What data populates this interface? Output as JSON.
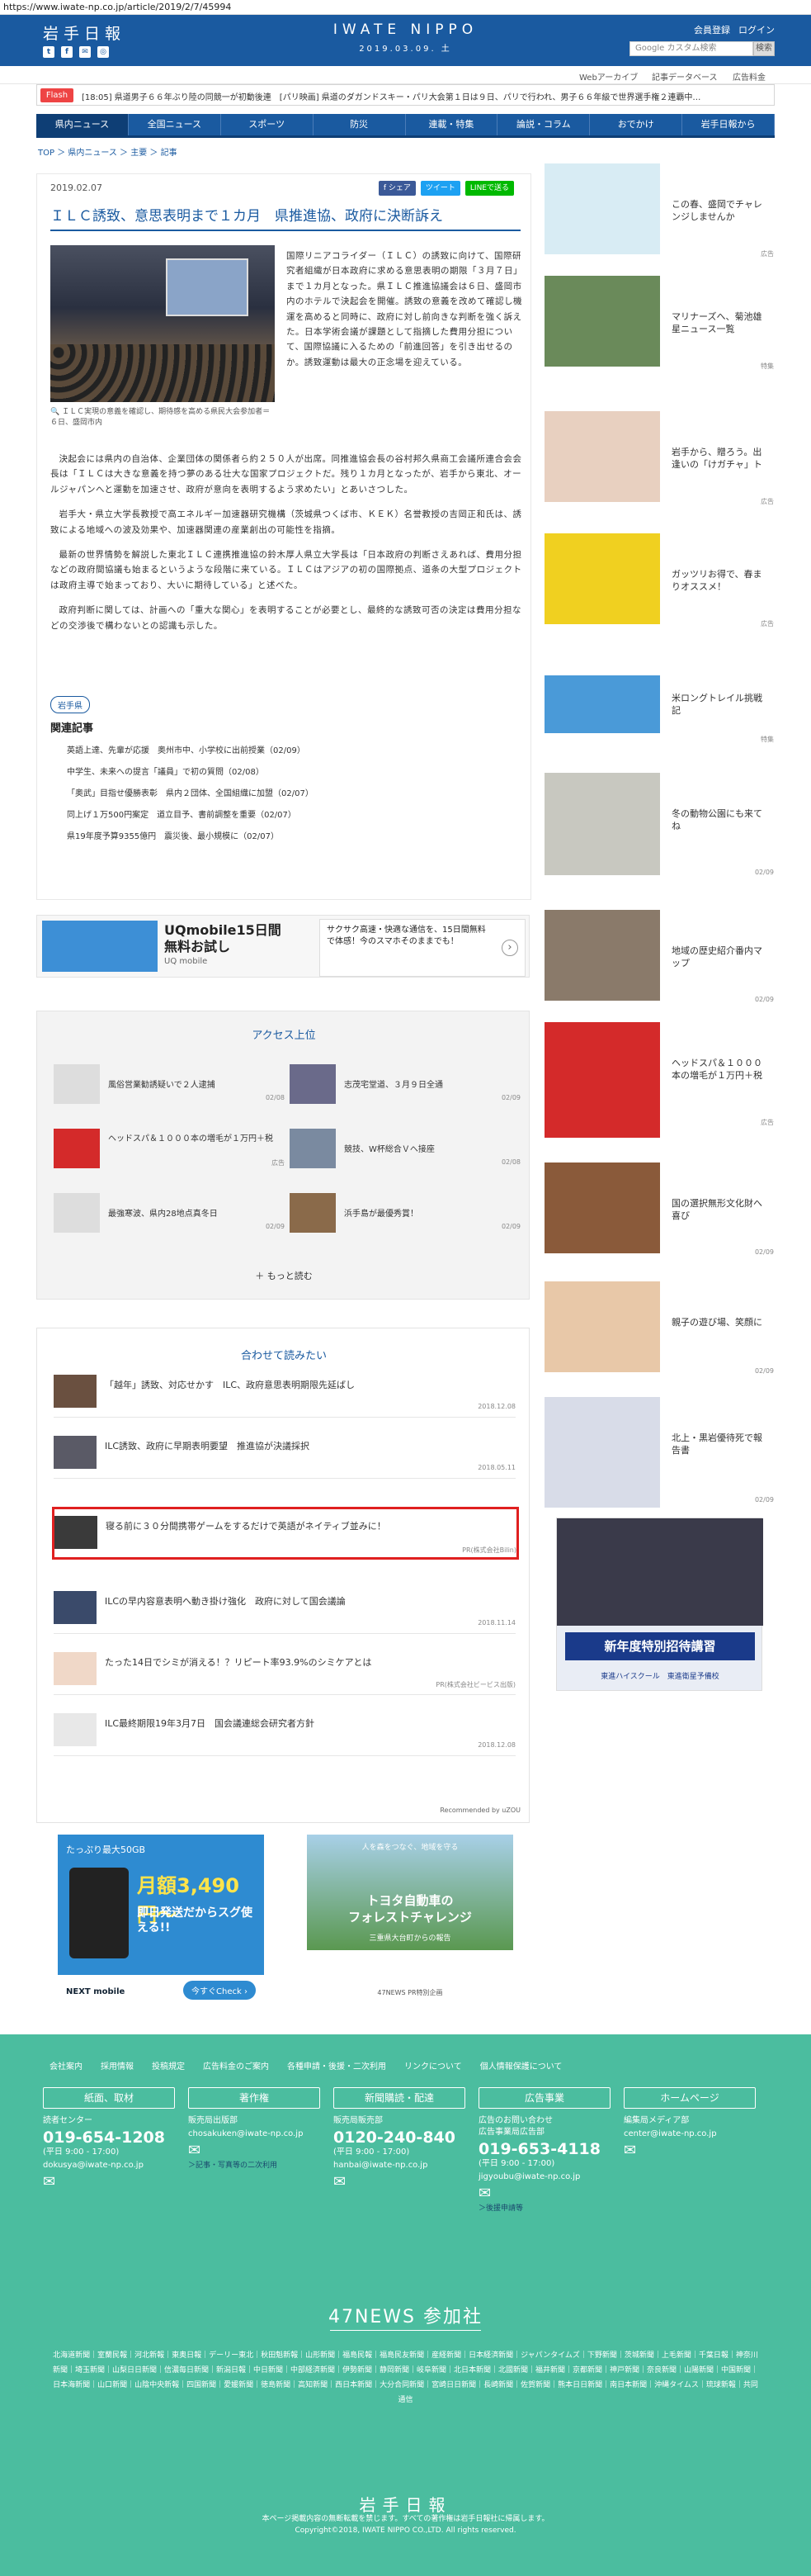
{
  "url": "https://www.iwate-np.co.jp/article/2019/2/7/45994",
  "header": {
    "logo": "岩手日報",
    "center_logo": "IWATE NIPPO",
    "date": "2019.03.09. 土",
    "links": [
      "会員登録",
      "ログイン"
    ],
    "search_placeholder": "Google カスタム検索",
    "search_button": "検索",
    "social": [
      "t",
      "f",
      "✉",
      "◎"
    ]
  },
  "subnav": [
    "Webアーカイブ",
    "記事データベース",
    "広告料金"
  ],
  "flash": {
    "label": "Flash",
    "text": "[18:05] 県道男子６６年ぶり陸の同競一が初動後連　[パリ映画] 県道のダガンドスキー・パリ大会第１日は９日、パリで行われ、男子６６年級で世界選手権２連覇中…"
  },
  "gnav": [
    "県内ニュース",
    "全国ニュース",
    "スポーツ",
    "防災",
    "連載・特集",
    "論説・コラム",
    "おでかけ",
    "岩手日報から"
  ],
  "breadcrumb": "TOP ＞ 県内ニュース ＞ 主要 ＞ 記事",
  "article": {
    "date": "2019.02.07",
    "share": [
      "f シェア",
      "ツイート",
      "LINEで送る"
    ],
    "title": "ＩＬＣ誘致、意思表明まで１カ月　県推進協、政府に決断訴え",
    "caption": "ＩＬＣ実現の意義を確認し、期待感を高める県民大会参加者＝６日、盛岡市内",
    "lead": "国際リニアコライダー（ＩＬＣ）の誘致に向けて、国際研究者組織が日本政府に求める意思表明の期限「３月７日」まで１カ月となった。県ＩＬＣ推進協議会は６日、盛岡市内のホテルで決起会を開催。誘致の意義を改めて確認し機運を高めると同時に、政府に対し前向きな判断を強く訴えた。日本学術会議が課題として指摘した費用分担について、国際協議に入るための「前進回答」を引き出せるのか。誘致運動は最大の正念場を迎えている。",
    "paragraphs": [
      "決起会には県内の自治体、企業団体の関係者ら約２５０人が出席。同推進協会長の谷村邦久県商工会議所連合会会長は「ＩＬＣは大きな意義を持つ夢のある壮大な国家プロジェクトだ。残り１カ月となったが、岩手から東北、オールジャパンへと運動を加速させ、政府が意向を表明するよう求めたい」とあいさつした。",
      "岩手大・県立大学長教授で高エネルギー加速器研究機構（茨城県つくば市、ＫＥＫ）名誉教授の吉岡正和氏は、誘致による地域への波及効果や、加速器関連の産業創出の可能性を指摘。",
      "最新の世界情勢を解説した東北ＩＬＣ連携推進協の鈴木厚人県立大学長は「日本政府の判断さえあれば、費用分担などの政府間協議も始まるというような段階に来ている。ＩＬＣはアジアの初の国際拠点、道条の大型プロジェクトは政府主導で始まっており、大いに期待している」と述べた。",
      "政府判断に関しては、計画への「重大な関心」を表明することが必要とし、最終的な誘致可否の決定は費用分担などの交渉後で構わないとの認識も示した。"
    ],
    "tag": "岩手県",
    "related_heading": "関連記事",
    "related": [
      "英語上達、先輩が応援　奥州市中、小学校に出前授業（02/09）",
      "中学生、未来への提言「議員」で初の質問（02/08）",
      "「奥武」目指せ優勝表彰　県内２団体、全国組織に加盟（02/07）",
      "同上げ１万500円案定　道立目予、書前調整を重要（02/07）",
      "県19年度予算9355億円　震災後、最小規模に（02/07）"
    ]
  },
  "ad_banner": {
    "title": "UQmobile15日間\n無料お試し",
    "sub": "UQ mobile",
    "right_text": "サクサク高速・快適な通信を、15日間無料で体感！今のスマホそのままでも！",
    "arrow": "›"
  },
  "ranking": {
    "heading": "アクセス上位",
    "items": [
      {
        "title": "風俗営業勧誘疑いで２人逮捕",
        "date": "02/08"
      },
      {
        "title": "志茂宅堂道、３月９日全通",
        "date": "02/09"
      },
      {
        "title": "ヘッドスパ＆１０００本の増毛が１万円＋税",
        "date": "広告"
      },
      {
        "title": "競技、W杯総合Ｖへ接座",
        "date": "02/08"
      },
      {
        "title": "最強寒波、県内28地点真冬日",
        "date": "02/09"
      },
      {
        "title": "浜手島が最優秀賞！",
        "date": "02/09"
      }
    ],
    "more": "＋ もっと読む"
  },
  "recommend": {
    "heading": "合わせて読みたい",
    "items": [
      {
        "title": "「越年」誘致、対応せかす　ILC、政府意思表明期限先延ばし",
        "date": "2018.12.08"
      },
      {
        "title": "ILC誘致、政府に早期表明要望　推進協が決議採択",
        "date": "2018.05.11"
      },
      {
        "title": "寝る前に３０分間携帯ゲームをするだけで英語がネイティブ並みに！",
        "date": "PR(株式会社Bilin)"
      },
      {
        "title": "ILCの早内容意表明へ動き掛け強化　政府に対して国会議論",
        "date": "2018.11.14"
      },
      {
        "title": "たった14日でシミが消える！？リピート率93.9%のシミケアとは",
        "date": "PR(株式会社ビービス出版)"
      },
      {
        "title": "ILC最終期限19年3月7日　国会議連総会研究者方針",
        "date": "2018.12.08"
      }
    ],
    "by": "Recommended by uZOU"
  },
  "bottom_ads": {
    "left_top": "たっぷり最大50GB",
    "left_price": "月額3,490円〜",
    "left_sub": "即日発送だからスグ使える!!",
    "left_btn": "今すぐCheck ›",
    "left_brand": "NEXT mobile",
    "right_top": "人を森をつなぐ、地域を守る",
    "right_title": "トヨタ自動車の\nフォレストチャレンジ",
    "right_sub": "三重県大台町からの報告",
    "right_brand": "47NEWS PR特別企画"
  },
  "sidebar": {
    "items": [
      {
        "title": "この春、盛岡でチャレンジしませんか",
        "date": "広告"
      },
      {
        "title": "マリナーズへ、菊池雄星ニュース一覧",
        "date": "特集"
      },
      {
        "title": "岩手から、贈ろう。出逢いの「けガチャ」ト",
        "date": "広告"
      },
      {
        "title": "ガッツリお得で、春まりオススメ！",
        "date": "広告"
      },
      {
        "title": "米ロングトレイル挑戦記",
        "date": "特集"
      },
      {
        "title": "冬の動物公園にも来てね",
        "date": "02/09"
      },
      {
        "title": "地域の歴史紹介番内マップ",
        "date": "02/09"
      },
      {
        "title": "ヘッドスパ＆１０００本の増毛が１万円＋税",
        "date": "広告"
      },
      {
        "title": "国の選択無形文化財へ喜び",
        "date": "02/09"
      },
      {
        "title": "親子の遊び場、笑顔に",
        "date": "02/09"
      },
      {
        "title": "北上・黒岩優待死で報告書",
        "date": "02/09"
      }
    ],
    "ad_title": "新年度特別招待講習",
    "ad_sub": "東進ハイスクール　東進衛星予備校"
  },
  "footer": {
    "links": [
      "会社案内",
      "採用情報",
      "投稿規定",
      "広告料金のご案内",
      "各種申請・後援・二次利用",
      "リンクについて",
      "個人情報保護について"
    ],
    "columns": [
      {
        "head": "紙面、取材",
        "text": "読者センター",
        "phone": "019-654-1208",
        "hours": "(平日 9:00 - 17:00)",
        "mail": "dokusya@iwate-np.co.jp",
        "link": ""
      },
      {
        "head": "著作権",
        "text": "販売局出版部",
        "phone": "",
        "hours": "",
        "mail": "chosakuken@iwate-np.co.jp",
        "link": "＞記事・写真等の二次利用"
      },
      {
        "head": "新聞購読・配達",
        "text": "販売局販売部",
        "phone": "0120-240-840",
        "hours": "(平日 9:00 - 17:00)",
        "mail": "hanbai@iwate-np.co.jp",
        "link": ""
      },
      {
        "head": "広告事業",
        "text": "広告のお問い合わせ\n広告事業局広告部",
        "phone": "019-653-4118",
        "hours": "(平日 9:00 - 17:00)",
        "mail": "jigyoubu@iwate-np.co.jp",
        "link": "＞後援申請等"
      },
      {
        "head": "ホームページ",
        "text": "編集局メディア部",
        "phone": "",
        "hours": "",
        "mail": "center@iwate-np.co.jp",
        "link": ""
      }
    ],
    "n47": "47NEWS 参加社",
    "papers": "北海道新聞｜室蘭民報｜河北新報｜東奥日報｜デーリー東北｜秋田魁新報｜山形新聞｜福島民報｜福島民友新聞｜産経新聞｜日本経済新聞｜ジャパンタイムズ｜下野新聞｜茨城新聞｜上毛新聞｜千葉日報｜神奈川新聞｜埼玉新聞｜山梨日日新聞｜信濃毎日新聞｜新潟日報｜中日新聞｜中部経済新聞｜伊勢新聞｜静岡新聞｜岐阜新聞｜北日本新聞｜北國新聞｜福井新聞｜京都新聞｜神戸新聞｜奈良新聞｜山陽新聞｜中国新聞｜日本海新聞｜山口新聞｜山陰中央新報｜四国新聞｜愛媛新聞｜徳島新聞｜高知新聞｜西日本新聞｜大分合同新聞｜宮崎日日新聞｜長崎新聞｜佐賀新聞｜熊本日日新聞｜南日本新聞｜沖縄タイムス｜琉球新報｜共同通信",
    "logo": "岩手日報",
    "notice": "本ページ掲載内容の無断転載を禁じます。すべての著作権は岩手日報社に帰属します。",
    "copyright": "Copyright©2018, IWATE NIPPO CO.,LTD. All rights reserved."
  }
}
